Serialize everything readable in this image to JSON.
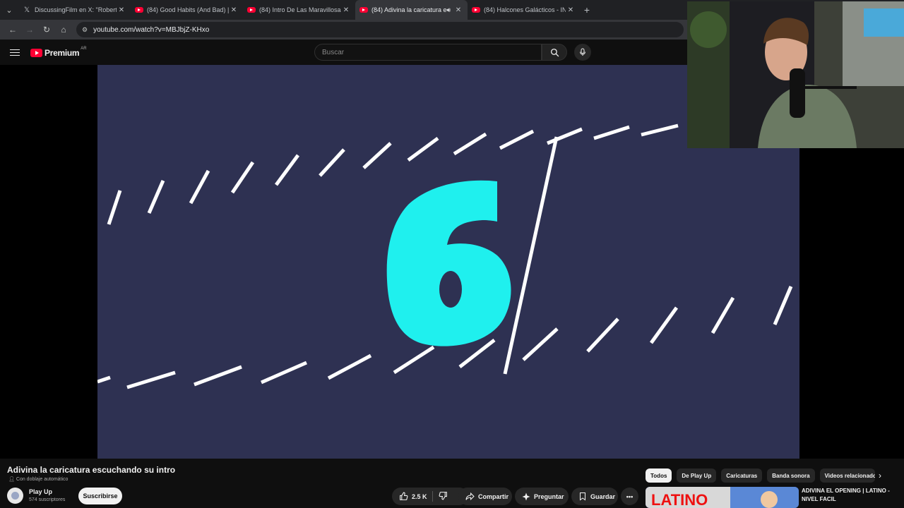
{
  "browser": {
    "tabs": [
      {
        "title": "DiscussingFilm en X: \"Robert D",
        "favicon": "x-icon",
        "active": false
      },
      {
        "title": "(84) Good Habits (And Bad) | Sa",
        "favicon": "youtube-icon",
        "active": false
      },
      {
        "title": "(84) Intro De Las Maravillosas D",
        "favicon": "youtube-icon",
        "active": false
      },
      {
        "title": "(84) Adivina la caricatura esc",
        "favicon": "youtube-icon",
        "active": true,
        "audio": true
      },
      {
        "title": "(84) Halcones Galácticos - INTR",
        "favicon": "youtube-icon",
        "active": false
      }
    ],
    "url": "youtube.com/watch?v=MBJbjZ-KHxo"
  },
  "masthead": {
    "brand": "Premium",
    "country": "AR",
    "search_placeholder": "Buscar"
  },
  "video": {
    "countdown_digit": "6",
    "colors": {
      "background": "#2e3152",
      "digit": "#1ff0ee",
      "stroke": "#ffffff"
    }
  },
  "watch": {
    "title": "Adivina la caricatura escuchando su intro",
    "dub_note": "Con doblaje automático",
    "channel": "Play Up",
    "subscribers": "574 suscriptores",
    "subscribe_label": "Suscribirse",
    "likes": "2.5 K",
    "share_label": "Compartir",
    "ask_label": "Preguntar",
    "save_label": "Guardar"
  },
  "chips": [
    "Todos",
    "De Play Up",
    "Caricaturas",
    "Banda sonora",
    "Videos relacionados"
  ],
  "recommendation": {
    "title": "ADIVINA EL OPENING | LATINO - NIVEL FACIL",
    "thumb_text": "LATINO"
  }
}
